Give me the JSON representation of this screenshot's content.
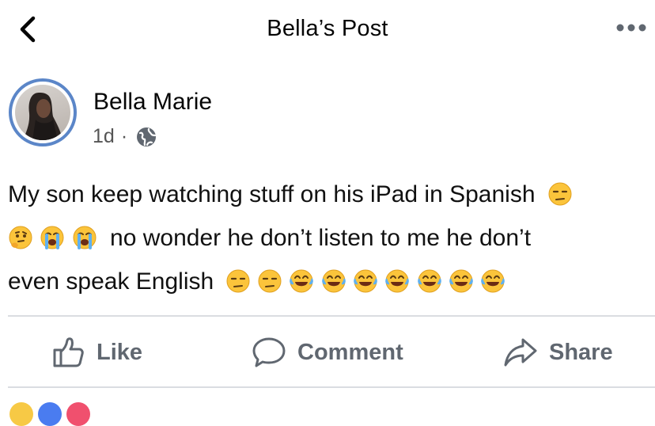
{
  "header": {
    "title": "Bella’s Post",
    "back_icon": "chevron-left-icon",
    "more_icon": "more-dots-icon"
  },
  "post": {
    "author": "Bella Marie",
    "time": "1d",
    "separator": "·",
    "privacy_icon": "globe-icon",
    "text_line1": "My son keep watching stuff on his iPad in Spanish",
    "text_line2": "no wonder he don’t listen to me he don’t",
    "text_line3": "even speak English"
  },
  "actions": {
    "like_label": "Like",
    "comment_label": "Comment",
    "share_label": "Share"
  },
  "colors": {
    "avatar_ring": "#5b86c8",
    "action_text": "#606770",
    "divider": "#dadde1"
  }
}
